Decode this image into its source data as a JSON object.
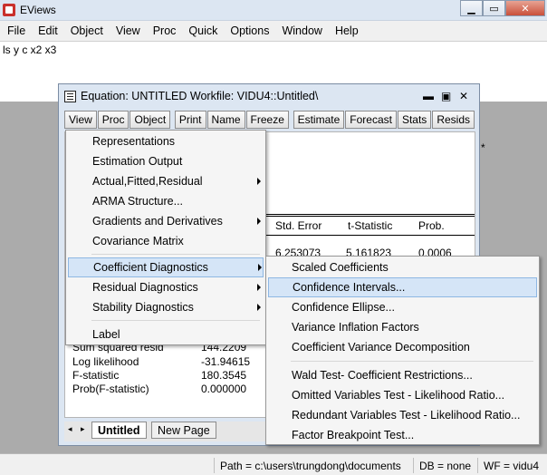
{
  "app": {
    "title": "EViews"
  },
  "menubar": [
    "File",
    "Edit",
    "Object",
    "View",
    "Proc",
    "Quick",
    "Options",
    "Window",
    "Help"
  ],
  "command": {
    "text": "ls y c x2 x3"
  },
  "equation_window": {
    "title": "Equation: UNTITLED   Workfile: VIDU4::Untitled\\",
    "toolbar": [
      "View",
      "Proc",
      "Object",
      "Print",
      "Name",
      "Freeze",
      "Estimate",
      "Forecast",
      "Stats",
      "Resids"
    ],
    "table": {
      "headers": [
        "Std. Error",
        "t-Statistic",
        "Prob."
      ],
      "row1": [
        "6.253073",
        "5.161823",
        "0.0006"
      ],
      "stats": [
        {
          "label": "Sum squared resid",
          "value": "144.2209"
        },
        {
          "label": "Log likelihood",
          "value": "-31.94615"
        },
        {
          "label": "F-statistic",
          "value": "180.3545"
        },
        {
          "label": "Prob(F-statistic)",
          "value": "0.000000"
        }
      ],
      "star": "*"
    },
    "tabs": {
      "active": "Untitled",
      "other": "New Page"
    }
  },
  "view_menu": {
    "items": [
      {
        "label": "Representations",
        "submenu": false
      },
      {
        "label": "Estimation Output",
        "submenu": false
      },
      {
        "label": "Actual,Fitted,Residual",
        "submenu": true
      },
      {
        "label": "ARMA Structure...",
        "submenu": false
      },
      {
        "label": "Gradients and Derivatives",
        "submenu": true
      },
      {
        "label": "Covariance Matrix",
        "submenu": false
      },
      {
        "label": "Coefficient Diagnostics",
        "submenu": true,
        "highlighted": true
      },
      {
        "label": "Residual Diagnostics",
        "submenu": true
      },
      {
        "label": "Stability Diagnostics",
        "submenu": true
      },
      {
        "label": "Label",
        "submenu": false
      }
    ]
  },
  "coef_submenu": {
    "items": [
      {
        "label": "Scaled Coefficients"
      },
      {
        "label": "Confidence Intervals...",
        "highlighted": true
      },
      {
        "label": "Confidence Ellipse..."
      },
      {
        "label": "Variance Inflation Factors"
      },
      {
        "label": "Coefficient Variance Decomposition"
      },
      {
        "label": "Wald Test- Coefficient Restrictions..."
      },
      {
        "label": "Omitted Variables Test - Likelihood Ratio..."
      },
      {
        "label": "Redundant Variables Test - Likelihood Ratio..."
      },
      {
        "label": "Factor Breakpoint Test..."
      }
    ]
  },
  "status": {
    "path": "Path = c:\\users\\trungdong\\documents",
    "db": "DB = none",
    "wf": "WF = vidu4"
  },
  "colors": {
    "title_bar": "#dce6f2",
    "highlight": "#d5e5f7",
    "workspace": "#ababab"
  }
}
